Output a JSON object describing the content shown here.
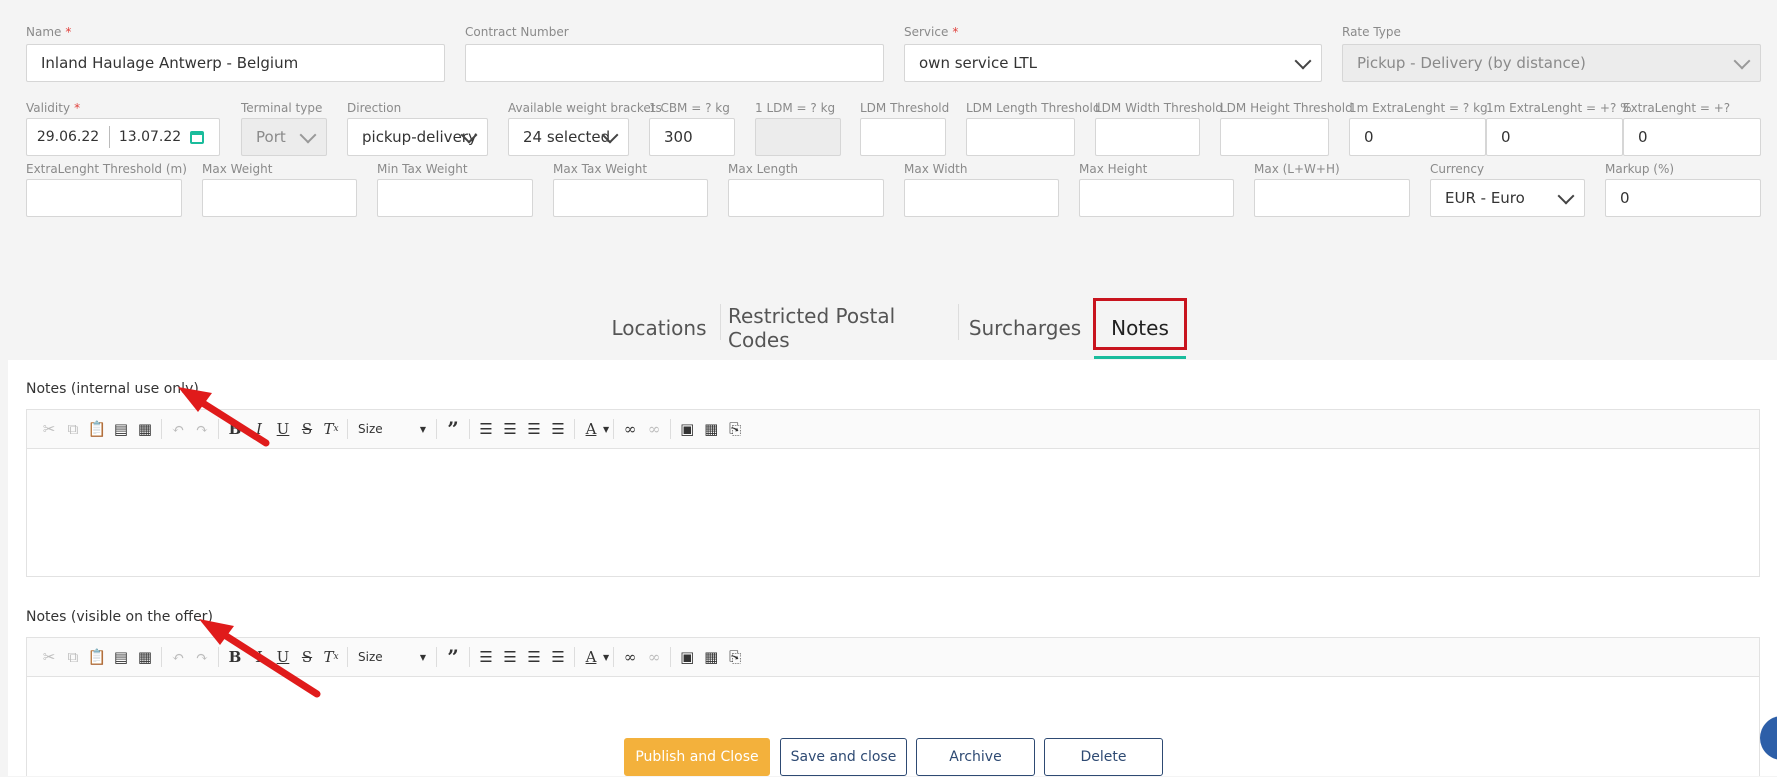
{
  "form": {
    "name": {
      "label": "Name",
      "required": "*",
      "value": "Inland Haulage Antwerp - Belgium"
    },
    "contract": {
      "label": "Contract Number",
      "value": ""
    },
    "service": {
      "label": "Service",
      "required": "*",
      "value": "own service LTL"
    },
    "rate_type": {
      "label": "Rate Type",
      "value": "Pickup - Delivery (by distance)"
    },
    "validity": {
      "label": "Validity",
      "required": "*",
      "from": "29.06.22",
      "to": "13.07.22"
    },
    "terminal_type": {
      "label": "Terminal type",
      "value": "Port"
    },
    "direction": {
      "label": "Direction",
      "value": "pickup-delivery"
    },
    "weight_brackets": {
      "label": "Available weight brackets",
      "value": "24 selected"
    },
    "cbm": {
      "label": "1 CBM = ? kg",
      "value": "300"
    },
    "ldm": {
      "label": "1 LDM = ? kg",
      "value": ""
    },
    "ldm_threshold": {
      "label": "LDM Threshold",
      "value": ""
    },
    "ldm_length_threshold": {
      "label": "LDM Length Threshold",
      "value": ""
    },
    "ldm_width_threshold": {
      "label": "LDM Width Threshold",
      "value": ""
    },
    "ldm_height_threshold": {
      "label": "LDM Height Threshold",
      "value": ""
    },
    "extra_length_kg": {
      "label": "1m ExtraLenght = ? kg",
      "value": "0"
    },
    "extra_length_pct": {
      "label": "1m ExtraLenght = +? %",
      "value": "0"
    },
    "extra_length_plus": {
      "label": "ExtraLenght = +?",
      "value": "0"
    },
    "extra_length_threshold": {
      "label": "ExtraLenght Threshold (m)",
      "value": ""
    },
    "max_weight": {
      "label": "Max Weight",
      "value": ""
    },
    "min_tax_weight": {
      "label": "Min Tax Weight",
      "value": ""
    },
    "max_tax_weight": {
      "label": "Max Tax Weight",
      "value": ""
    },
    "max_length": {
      "label": "Max Length",
      "value": ""
    },
    "max_width": {
      "label": "Max Width",
      "value": ""
    },
    "max_height": {
      "label": "Max Height",
      "value": ""
    },
    "max_lwh": {
      "label": "Max (L+W+H)",
      "value": ""
    },
    "currency": {
      "label": "Currency",
      "value": "EUR - Euro"
    },
    "markup": {
      "label": "Markup (%)",
      "value": "0"
    }
  },
  "tabs": [
    {
      "label": "Locations"
    },
    {
      "label": "Restricted Postal Codes"
    },
    {
      "label": "Surcharges"
    },
    {
      "label": "Notes",
      "active": true
    }
  ],
  "notes": {
    "internal_label": "Notes (internal use only)",
    "offer_label": "Notes (visible on the offer)",
    "toolbar": {
      "size_label": "Size"
    }
  },
  "actions": {
    "publish": "Publish and Close",
    "save": "Save and close",
    "archive": "Archive",
    "delete": "Delete"
  },
  "colors": {
    "accent": "#1abc9c",
    "primary_button": "#f3b13c",
    "highlight_box": "#c8141e",
    "arrow": "#e01b1b",
    "outline_button": "#2e4a73"
  }
}
